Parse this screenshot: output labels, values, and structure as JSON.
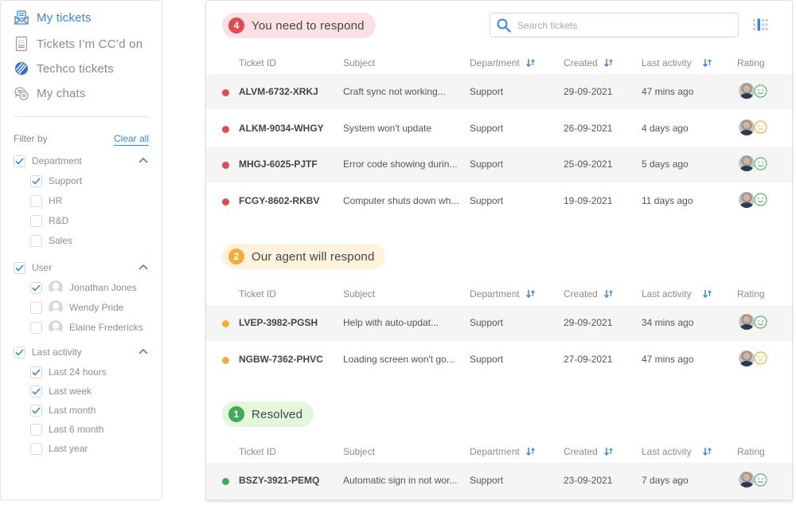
{
  "sidebar": {
    "nav": [
      {
        "label": "My tickets",
        "icon": "inbox-envelope-icon",
        "active": true
      },
      {
        "label": "Tickets I’m CC’d on",
        "icon": "cc-document-icon",
        "active": false
      },
      {
        "label": "Techco tickets",
        "icon": "techco-logo-icon",
        "active": false
      },
      {
        "label": "My chats",
        "icon": "chat-bubbles-icon",
        "active": false
      }
    ],
    "filter_title": "Filter by",
    "clear_all": "Clear all",
    "groups": {
      "department": {
        "label": "Department",
        "checked": true,
        "items": [
          {
            "label": "Support",
            "checked": true
          },
          {
            "label": "HR",
            "checked": false
          },
          {
            "label": "R&D",
            "checked": false
          },
          {
            "label": "Sales",
            "checked": false
          }
        ]
      },
      "user": {
        "label": "User",
        "checked": true,
        "items": [
          {
            "label": "Jonathan Jones",
            "checked": true
          },
          {
            "label": "Wendy Pride",
            "checked": false
          },
          {
            "label": "Elaine Fredericks",
            "checked": false
          }
        ]
      },
      "last_activity": {
        "label": "Last activity",
        "checked": true,
        "items": [
          {
            "label": "Last 24 hours",
            "checked": true
          },
          {
            "label": "Last week",
            "checked": true
          },
          {
            "label": "Last month",
            "checked": true
          },
          {
            "label": "Last 6 month",
            "checked": false
          },
          {
            "label": "Last year",
            "checked": false
          }
        ]
      }
    }
  },
  "search": {
    "placeholder": "Search tickets",
    "value": ""
  },
  "columns": {
    "ticket_id": "Ticket ID",
    "subject": "Subject",
    "department": "Department",
    "created": "Created",
    "last_activity": "Last activity",
    "rating": "Rating"
  },
  "sections": [
    {
      "title": "You need to respond",
      "count": "4",
      "color": "#e04a52",
      "rows": [
        {
          "id": "ALVM-6732-XRKJ",
          "subject": "Craft sync not working...",
          "department": "Support",
          "created": "29-09-2021",
          "last_activity": "47 mins ago",
          "rating": "happy"
        },
        {
          "id": "ALKM-9034-WHGY",
          "subject": "System won't update",
          "department": "Support",
          "created": "26-09-2021",
          "last_activity": "4 days ago",
          "rating": "neutral"
        },
        {
          "id": "MHGJ-6025-PJTF",
          "subject": "Error code showing durin...",
          "department": "Support",
          "created": "25-09-2021",
          "last_activity": "5 days ago",
          "rating": "happy"
        },
        {
          "id": "FCGY-8602-RKBV",
          "subject": "Computer shuts down wh...",
          "department": "Support",
          "created": "19-09-2021",
          "last_activity": "11 days ago",
          "rating": "happy"
        }
      ]
    },
    {
      "title": "Our agent will respond",
      "count": "2",
      "color": "#f4ac3a",
      "rows": [
        {
          "id": "LVEP-3982-PGSH",
          "subject": "Help with auto-updat...",
          "department": "Support",
          "created": "29-09-2021",
          "last_activity": "34 mins ago",
          "rating": "happy"
        },
        {
          "id": "NGBW-7362-PHVC",
          "subject": "Loading screen won't go...",
          "department": "Support",
          "created": "27-09-2021",
          "last_activity": "47 mins ago",
          "rating": "neutral"
        }
      ]
    },
    {
      "title": "Resolved",
      "count": "1",
      "color": "#42a85a",
      "rows": [
        {
          "id": "BSZY-3921-PEMQ",
          "subject": "Automatic sign in not wor...",
          "department": "Support",
          "created": "23-09-2021",
          "last_activity": "7 days ago",
          "rating": "happy"
        }
      ]
    }
  ],
  "colors": {
    "accent": "#3b86d6",
    "happy": "#4cb865",
    "neutral": "#f4ac3a"
  }
}
